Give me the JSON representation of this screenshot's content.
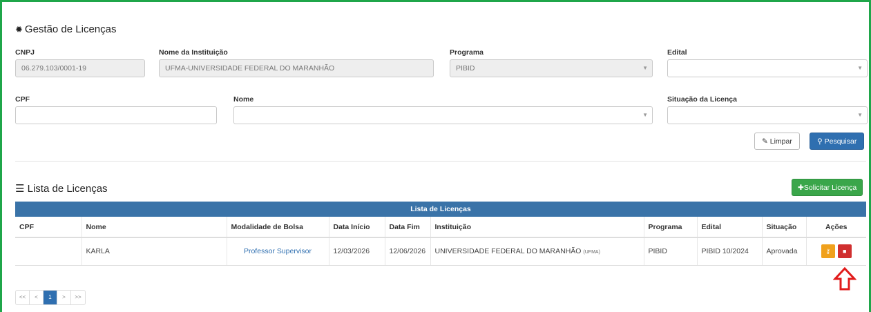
{
  "header": {
    "title": "Gestão de Licenças"
  },
  "filters": {
    "cnpj": {
      "label": "CNPJ",
      "value": "06.279.103/0001-19"
    },
    "instituicao": {
      "label": "Nome da Instituição",
      "value": "UFMA-UNIVERSIDADE FEDERAL DO MARANHÃO"
    },
    "programa": {
      "label": "Programa",
      "value": "PIBID"
    },
    "edital": {
      "label": "Edital",
      "value": ""
    },
    "cpf": {
      "label": "CPF",
      "value": ""
    },
    "nome": {
      "label": "Nome",
      "value": ""
    },
    "situacao": {
      "label": "Situação da Licença",
      "value": ""
    }
  },
  "buttons": {
    "limpar": "Limpar",
    "pesquisar": "Pesquisar",
    "solicitar": "Solicitar Licença"
  },
  "list": {
    "section_title": "Lista de Licenças",
    "table_title": "Lista de Licenças",
    "columns": [
      "CPF",
      "Nome",
      "Modalidade de Bolsa",
      "Data Início",
      "Data Fim",
      "Instituição",
      "Programa",
      "Edital",
      "Situação",
      "Ações"
    ],
    "rows": [
      {
        "cpf": "",
        "nome": "KARLA",
        "modalidade": "Professor Supervisor",
        "data_inicio": "12/03/2026",
        "data_fim": "12/06/2026",
        "instituicao": "UNIVERSIDADE FEDERAL DO MARANHÃO",
        "instituicao_sigla": "(UFMA)",
        "programa": "PIBID",
        "edital": "PIBID 10/2024",
        "situacao": "Aprovada"
      }
    ]
  },
  "pagination": {
    "first": "<<",
    "prev": "<",
    "current": "1",
    "next": ">",
    "last": ">>"
  },
  "icons": {
    "gear": "gear-icon",
    "list": "list-icon",
    "eraser": "eraser-icon",
    "search": "search-icon",
    "plus": "plus-icon",
    "edit": "key-icon",
    "delete": "trash-icon",
    "annotation": "arrow-up-icon"
  },
  "colors": {
    "frame": "#1fa64a",
    "primary": "#2f6fb0",
    "success": "#3aa64a",
    "warning": "#f0a11c",
    "danger": "#d02f2f",
    "annotation": "#e11b1b"
  }
}
